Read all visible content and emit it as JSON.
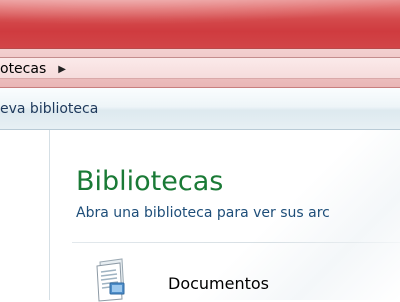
{
  "address_bar": {
    "breadcrumb": "otecas",
    "arrow_icon": "chevron-right-icon"
  },
  "toolbar": {
    "new_library_label": "eva biblioteca"
  },
  "main": {
    "title": "Bibliotecas",
    "subtitle": "Abra una biblioteca para ver sus arc",
    "libraries": [
      {
        "name": "Documentos",
        "icon": "documents-library-icon"
      }
    ]
  },
  "colors": {
    "frame": "#d44a4c",
    "title_green": "#1a7a36",
    "subtitle_blue": "#1e4e79",
    "toolbar_text": "#1e395b"
  }
}
